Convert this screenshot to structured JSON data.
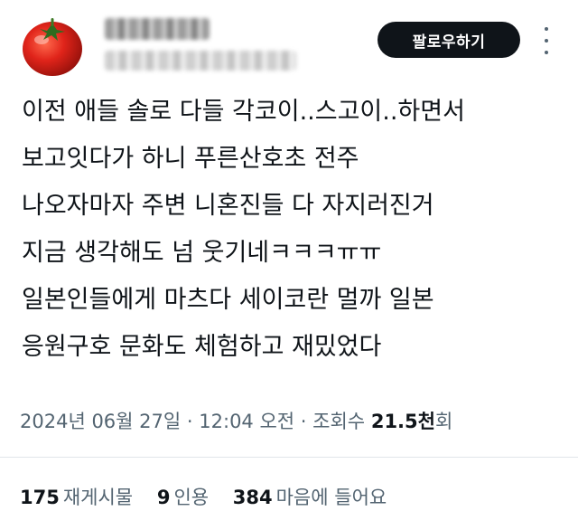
{
  "header": {
    "follow_label": "팔로우하기"
  },
  "tweet": {
    "lines": [
      "이전 애들 솔로 다들 각코이..스고이..하면서",
      "보고잇다가 하니 푸른산호초 전주",
      "나오자마자 주변 니혼진들 다 자지러진거",
      "지금 생각해도 넘 웃기네ㅋㅋㅋㅠㅠ",
      "일본인들에게 마츠다 세이코란 멀까 일본",
      "응원구호 문화도 체험하고 재밌었다"
    ]
  },
  "meta": {
    "date": "2024년 06월 27일",
    "separator": "·",
    "time": "12:04 오전",
    "views_label": "조회수",
    "views_count": "21.5천",
    "views_unit": "회"
  },
  "stats": {
    "retweets": {
      "count": "175",
      "label": "재게시물"
    },
    "quotes": {
      "count": "9",
      "label": "인용"
    },
    "likes": {
      "count": "384",
      "label": "마음에 들어요"
    }
  },
  "colors": {
    "text_primary": "#0f1419",
    "text_secondary": "#536471",
    "button_bg": "#0f1419",
    "divider": "#e1e6ea"
  },
  "icons": {
    "avatar": "tomato-avatar",
    "more": "more-icon"
  }
}
